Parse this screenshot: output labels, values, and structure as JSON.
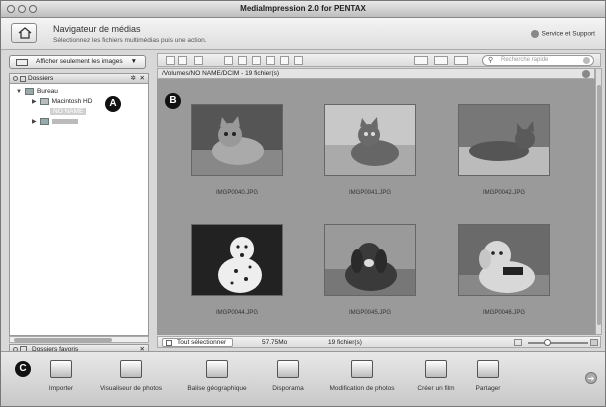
{
  "window": {
    "title": "MediaImpression 2.0 for PENTAX"
  },
  "header": {
    "title": "Navigateur de médias",
    "subtitle": "Sélectionnez les fichiers multimédias puis une action.",
    "support": "Service et Support"
  },
  "left": {
    "filter_label": "Afficher seulement les images",
    "folders_label": "Dossiers",
    "tree": {
      "root": "Bureau",
      "disk": "Macintosh HD",
      "selected": "NO NAME"
    },
    "favorites_label": "Dossiers favoris"
  },
  "main": {
    "search_placeholder": "Recherche rapide",
    "path": "/Volumes/NO NAME/DCIM - 19 fichier(s)",
    "thumbnails": [
      {
        "name": "IMGP0040.JPG"
      },
      {
        "name": "IMGP0041.JPG"
      },
      {
        "name": "IMGP0042.JPG"
      },
      {
        "name": "IMGP0044.JPG"
      },
      {
        "name": "IMGP0045.JPG"
      },
      {
        "name": "IMGP0046.JPG"
      }
    ]
  },
  "status": {
    "select_all": "Tout sélectionner",
    "size": "57.75Mo",
    "count": "19 fichier(s)"
  },
  "tools": {
    "importer": "Importer",
    "viewer": "Visualiseur de photos",
    "geotag": "Balise géographique",
    "disporama": "Disporama",
    "edit": "Modification de photos",
    "movie": "Créer un film",
    "share": "Partager"
  },
  "markers": {
    "a": "A",
    "b": "B",
    "c": "C"
  }
}
